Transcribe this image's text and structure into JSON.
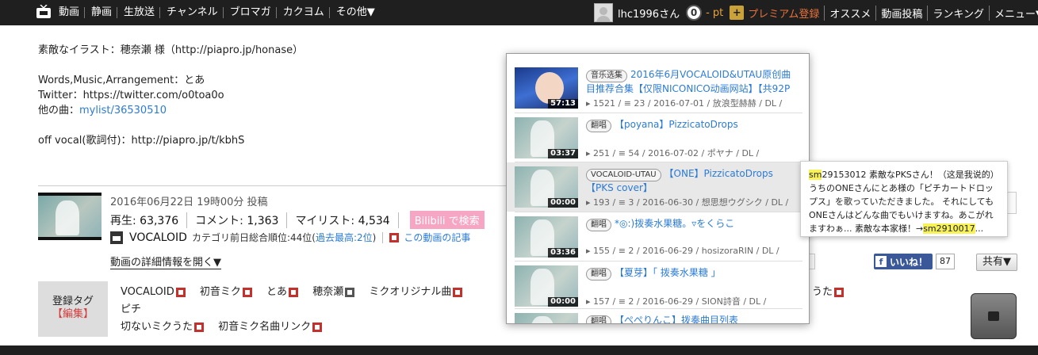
{
  "topbar": {
    "nav": [
      "動画",
      "静画",
      "生放送",
      "チャンネル",
      "ブロマガ",
      "カクヨム",
      "その他▼"
    ],
    "user_name": "lhc1996さん",
    "points": "0",
    "points_label": "- pt",
    "premium_plus": "+",
    "premium_label": "プレミアム登録",
    "links": [
      "オススメ",
      "動画投稿",
      "ランキング",
      "メニュー▼"
    ]
  },
  "description": {
    "line1": "素敵なイラスト：穂奈瀬 様（http://piapro.jp/honase）",
    "line2": "Words,Music,Arrangement：とあ",
    "line3": "Twitter：https://twitter.com/o0toa0o",
    "line4_prefix": "他の曲：",
    "line4_link": "mylist/36530510",
    "line5": "off vocal(歌詞付)：http://piapro.jp/t/kbhS"
  },
  "video_info": {
    "posted": "2016年06月22日 19時00分 投稿",
    "views_label": "再生:",
    "views": "63,376",
    "comments_label": "コメント:",
    "comments": "1,363",
    "mylist_label": "マイリスト:",
    "mylist": "4,534",
    "bilibili_button": "Bilibili で検索",
    "category": "VOCALOID",
    "rank_prefix": "カテゴリ前日総合順位:44位(",
    "rank_link": "過去最高:2位",
    "rank_suffix": ")",
    "article_link": "この動画の記事",
    "detail_link": "動画の詳細情報を開く▼"
  },
  "tags": {
    "box_label": "登録タグ",
    "box_edit": "【編集】",
    "items": [
      "VOCALOID",
      "初音ミク",
      "とあ",
      "穂奈瀬",
      "ミクオリジナル曲",
      "ピチ"
    ],
    "row2": [
      "切ないミクうた",
      "初音ミク名曲リンク"
    ],
    "cut_right": "うた"
  },
  "social": {
    "like_icon": "f",
    "like_label": "いいね！",
    "like_count": "87",
    "share_label": "共有▼"
  },
  "popup": {
    "items": [
      {
        "type": "音乐选集",
        "title": "2016年6月VOCALOID&UTAU原创曲目推荐合集【仅限NICONICO动画网站】【共92P",
        "duration": "57:13",
        "meta": "▸ 1521 /  ≡ 23 /  2016-07-01 /  放浪型赫赫 /  DL /"
      },
      {
        "type": "翻唱",
        "title": "【poyana】PizzicatoDrops",
        "duration": "03:37",
        "meta": "▸ 251 /  ≡ 54 /  2016-07-02 /  ポヤナ /  DL /"
      },
      {
        "type": "VOCALOID-UTAU",
        "title": "【ONE】PizzicatoDrops【PKS cover】",
        "duration": "00:00",
        "meta": "▸ 193 /  ≡ 3 /  2016-06-30 /  想思想ウグシク /  DL /"
      },
      {
        "type": "翻唱",
        "title": "*◎:)拨奏水果糖。▿をくらこ",
        "duration": "03:36",
        "meta": "▸ 155 /  ≡ 2 /  2016-06-29 /  hosizoraRIN /  DL /"
      },
      {
        "type": "翻唱",
        "title": "【夏芽】「 拨奏水果糖 」",
        "duration": "00:00",
        "meta": "▸ 157 /  ≡ 2 /  2016-06-29 /  SION詩音 /  DL /"
      },
      {
        "type": "翻唱",
        "title": "【ぺぺりんこ】拨奏曲目列表",
        "duration": "",
        "meta": ""
      }
    ]
  },
  "bubble": {
    "hl_prefix": "sm",
    "text": "29153012 素敵なPKSさん！（这是我说的）うちのONEさんにとあ様の「ピチカートドロップス」を歌っていただきました。 それにしてもONEさんはどんな曲でもいけますね。あこがれますわぁ... 素敵な本家様！→",
    "link": "sm2910017",
    "ellipsis": "..."
  }
}
